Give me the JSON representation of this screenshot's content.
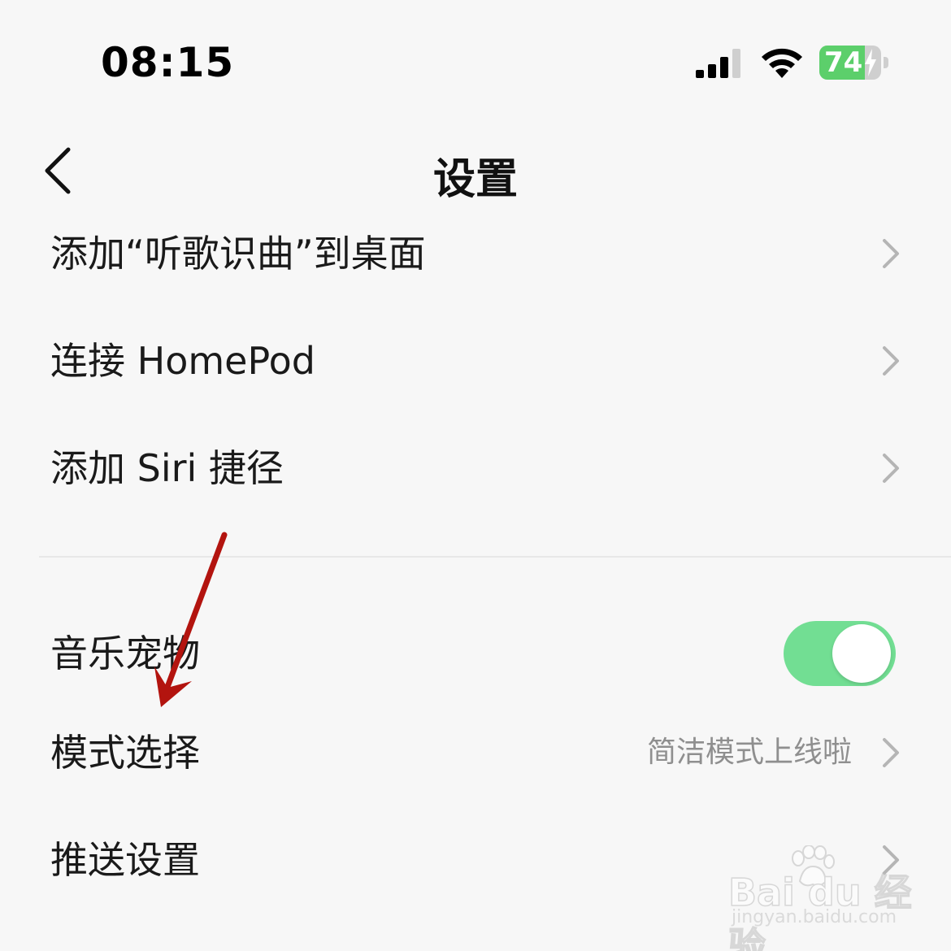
{
  "status_bar": {
    "time": "08:15",
    "battery_level": "74",
    "battery_fraction": 0.74,
    "icons": [
      "cellular-signal-icon",
      "wifi-icon",
      "battery-charging-icon"
    ]
  },
  "nav": {
    "title": "设置",
    "back_icon": "chevron-left-icon"
  },
  "rows": [
    {
      "label": "添加“听歌识曲”到桌面",
      "has_chevron": true
    },
    {
      "label": "连接 HomePod",
      "has_chevron": true
    },
    {
      "label": "添加 Siri 捷径",
      "has_chevron": true
    },
    {
      "label": "音乐宠物",
      "toggle": true,
      "toggle_on": true
    },
    {
      "label": "模式选择",
      "value": "简洁模式上线啦",
      "has_chevron": true
    },
    {
      "label": "推送设置",
      "has_chevron": true
    }
  ],
  "colors": {
    "background": "#f7f7f7",
    "toggle_on": "#72de93",
    "battery_green": "#5ccf6b",
    "annotation_arrow": "#b3140f"
  },
  "watermark": {
    "brand": "Bai du 经验",
    "url": "jingyan.baidu.com"
  }
}
